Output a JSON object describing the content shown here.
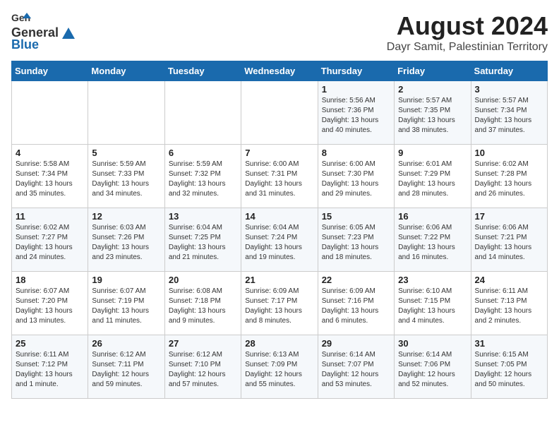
{
  "header": {
    "logo_general": "General",
    "logo_blue": "Blue",
    "title": "August 2024",
    "subtitle": "Dayr Samit, Palestinian Territory"
  },
  "days_of_week": [
    "Sunday",
    "Monday",
    "Tuesday",
    "Wednesday",
    "Thursday",
    "Friday",
    "Saturday"
  ],
  "weeks": [
    [
      {
        "day": "",
        "sunrise": "",
        "sunset": "",
        "daylight": ""
      },
      {
        "day": "",
        "sunrise": "",
        "sunset": "",
        "daylight": ""
      },
      {
        "day": "",
        "sunrise": "",
        "sunset": "",
        "daylight": ""
      },
      {
        "day": "",
        "sunrise": "",
        "sunset": "",
        "daylight": ""
      },
      {
        "day": "1",
        "sunrise": "Sunrise: 5:56 AM",
        "sunset": "Sunset: 7:36 PM",
        "daylight": "Daylight: 13 hours and 40 minutes."
      },
      {
        "day": "2",
        "sunrise": "Sunrise: 5:57 AM",
        "sunset": "Sunset: 7:35 PM",
        "daylight": "Daylight: 13 hours and 38 minutes."
      },
      {
        "day": "3",
        "sunrise": "Sunrise: 5:57 AM",
        "sunset": "Sunset: 7:34 PM",
        "daylight": "Daylight: 13 hours and 37 minutes."
      }
    ],
    [
      {
        "day": "4",
        "sunrise": "Sunrise: 5:58 AM",
        "sunset": "Sunset: 7:34 PM",
        "daylight": "Daylight: 13 hours and 35 minutes."
      },
      {
        "day": "5",
        "sunrise": "Sunrise: 5:59 AM",
        "sunset": "Sunset: 7:33 PM",
        "daylight": "Daylight: 13 hours and 34 minutes."
      },
      {
        "day": "6",
        "sunrise": "Sunrise: 5:59 AM",
        "sunset": "Sunset: 7:32 PM",
        "daylight": "Daylight: 13 hours and 32 minutes."
      },
      {
        "day": "7",
        "sunrise": "Sunrise: 6:00 AM",
        "sunset": "Sunset: 7:31 PM",
        "daylight": "Daylight: 13 hours and 31 minutes."
      },
      {
        "day": "8",
        "sunrise": "Sunrise: 6:00 AM",
        "sunset": "Sunset: 7:30 PM",
        "daylight": "Daylight: 13 hours and 29 minutes."
      },
      {
        "day": "9",
        "sunrise": "Sunrise: 6:01 AM",
        "sunset": "Sunset: 7:29 PM",
        "daylight": "Daylight: 13 hours and 28 minutes."
      },
      {
        "day": "10",
        "sunrise": "Sunrise: 6:02 AM",
        "sunset": "Sunset: 7:28 PM",
        "daylight": "Daylight: 13 hours and 26 minutes."
      }
    ],
    [
      {
        "day": "11",
        "sunrise": "Sunrise: 6:02 AM",
        "sunset": "Sunset: 7:27 PM",
        "daylight": "Daylight: 13 hours and 24 minutes."
      },
      {
        "day": "12",
        "sunrise": "Sunrise: 6:03 AM",
        "sunset": "Sunset: 7:26 PM",
        "daylight": "Daylight: 13 hours and 23 minutes."
      },
      {
        "day": "13",
        "sunrise": "Sunrise: 6:04 AM",
        "sunset": "Sunset: 7:25 PM",
        "daylight": "Daylight: 13 hours and 21 minutes."
      },
      {
        "day": "14",
        "sunrise": "Sunrise: 6:04 AM",
        "sunset": "Sunset: 7:24 PM",
        "daylight": "Daylight: 13 hours and 19 minutes."
      },
      {
        "day": "15",
        "sunrise": "Sunrise: 6:05 AM",
        "sunset": "Sunset: 7:23 PM",
        "daylight": "Daylight: 13 hours and 18 minutes."
      },
      {
        "day": "16",
        "sunrise": "Sunrise: 6:06 AM",
        "sunset": "Sunset: 7:22 PM",
        "daylight": "Daylight: 13 hours and 16 minutes."
      },
      {
        "day": "17",
        "sunrise": "Sunrise: 6:06 AM",
        "sunset": "Sunset: 7:21 PM",
        "daylight": "Daylight: 13 hours and 14 minutes."
      }
    ],
    [
      {
        "day": "18",
        "sunrise": "Sunrise: 6:07 AM",
        "sunset": "Sunset: 7:20 PM",
        "daylight": "Daylight: 13 hours and 13 minutes."
      },
      {
        "day": "19",
        "sunrise": "Sunrise: 6:07 AM",
        "sunset": "Sunset: 7:19 PM",
        "daylight": "Daylight: 13 hours and 11 minutes."
      },
      {
        "day": "20",
        "sunrise": "Sunrise: 6:08 AM",
        "sunset": "Sunset: 7:18 PM",
        "daylight": "Daylight: 13 hours and 9 minutes."
      },
      {
        "day": "21",
        "sunrise": "Sunrise: 6:09 AM",
        "sunset": "Sunset: 7:17 PM",
        "daylight": "Daylight: 13 hours and 8 minutes."
      },
      {
        "day": "22",
        "sunrise": "Sunrise: 6:09 AM",
        "sunset": "Sunset: 7:16 PM",
        "daylight": "Daylight: 13 hours and 6 minutes."
      },
      {
        "day": "23",
        "sunrise": "Sunrise: 6:10 AM",
        "sunset": "Sunset: 7:15 PM",
        "daylight": "Daylight: 13 hours and 4 minutes."
      },
      {
        "day": "24",
        "sunrise": "Sunrise: 6:11 AM",
        "sunset": "Sunset: 7:13 PM",
        "daylight": "Daylight: 13 hours and 2 minutes."
      }
    ],
    [
      {
        "day": "25",
        "sunrise": "Sunrise: 6:11 AM",
        "sunset": "Sunset: 7:12 PM",
        "daylight": "Daylight: 13 hours and 1 minute."
      },
      {
        "day": "26",
        "sunrise": "Sunrise: 6:12 AM",
        "sunset": "Sunset: 7:11 PM",
        "daylight": "Daylight: 12 hours and 59 minutes."
      },
      {
        "day": "27",
        "sunrise": "Sunrise: 6:12 AM",
        "sunset": "Sunset: 7:10 PM",
        "daylight": "Daylight: 12 hours and 57 minutes."
      },
      {
        "day": "28",
        "sunrise": "Sunrise: 6:13 AM",
        "sunset": "Sunset: 7:09 PM",
        "daylight": "Daylight: 12 hours and 55 minutes."
      },
      {
        "day": "29",
        "sunrise": "Sunrise: 6:14 AM",
        "sunset": "Sunset: 7:07 PM",
        "daylight": "Daylight: 12 hours and 53 minutes."
      },
      {
        "day": "30",
        "sunrise": "Sunrise: 6:14 AM",
        "sunset": "Sunset: 7:06 PM",
        "daylight": "Daylight: 12 hours and 52 minutes."
      },
      {
        "day": "31",
        "sunrise": "Sunrise: 6:15 AM",
        "sunset": "Sunset: 7:05 PM",
        "daylight": "Daylight: 12 hours and 50 minutes."
      }
    ]
  ]
}
